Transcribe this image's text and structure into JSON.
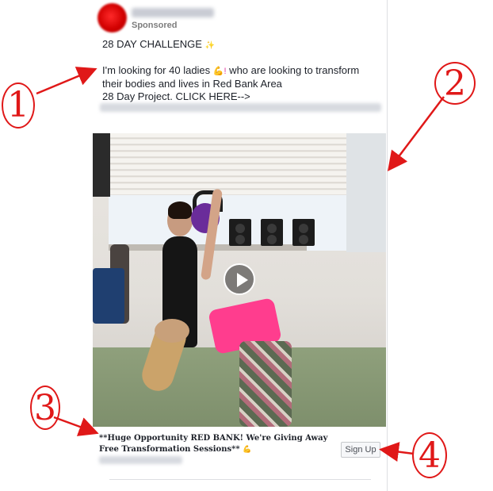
{
  "post": {
    "sponsored_label": "Sponsored",
    "headline": "28 DAY CHALLENGE",
    "headline_emoji": "✨",
    "body_line1_a": "I'm looking for 40 ladies",
    "body_line1_emoji": "💪!",
    "body_line1_b": " who are looking to transform their bodies and lives in Red Bank Area",
    "body_line2": "28 Day Project. CLICK HERE-->"
  },
  "video": {
    "play_icon": "play-icon"
  },
  "link_card": {
    "title": "**Huge Opportunity RED BANK! We're Giving Away Free Transformation Sessions**",
    "title_emoji": "💪",
    "cta_label": "Sign Up"
  },
  "annotations": {
    "callout1": "1",
    "callout2": "2",
    "callout3": "3",
    "callout4": "4",
    "color": "#e01818"
  }
}
